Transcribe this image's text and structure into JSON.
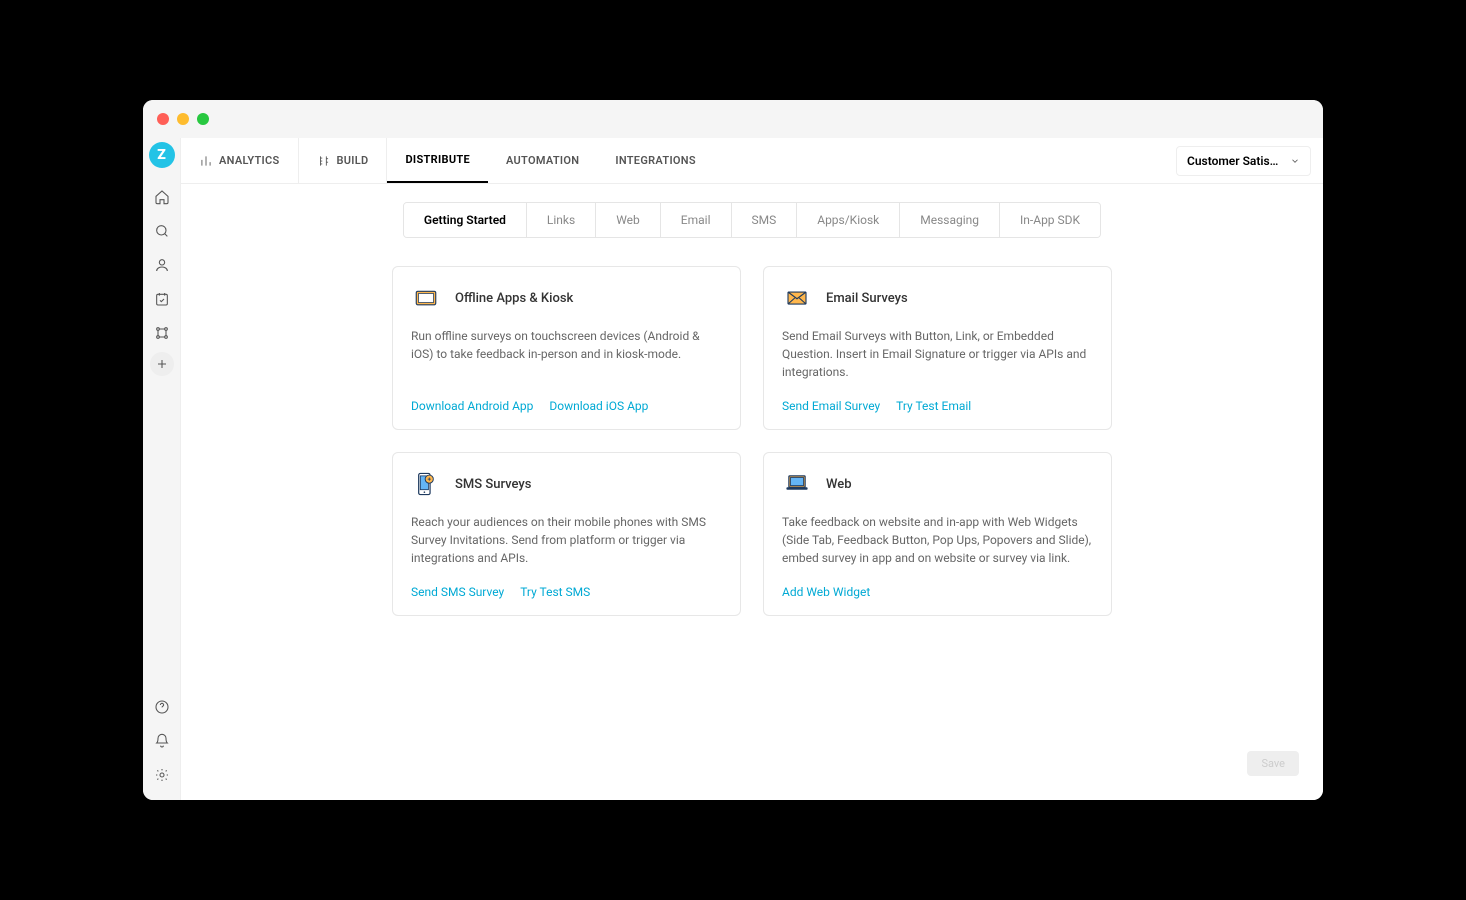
{
  "logo_letter": "Z",
  "topnav": {
    "items": [
      {
        "label": "ANALYTICS",
        "has_icon": true
      },
      {
        "label": "BUILD",
        "has_icon": true
      },
      {
        "label": "DISTRIBUTE",
        "active": true
      },
      {
        "label": "AUTOMATION"
      },
      {
        "label": "INTEGRATIONS"
      }
    ]
  },
  "project_selector": "Customer Satisfaction ...",
  "subnav": {
    "items": [
      {
        "label": "Getting Started",
        "active": true
      },
      {
        "label": "Links"
      },
      {
        "label": "Web"
      },
      {
        "label": "Email"
      },
      {
        "label": "SMS"
      },
      {
        "label": "Apps/Kiosk"
      },
      {
        "label": "Messaging"
      },
      {
        "label": "In-App SDK"
      }
    ]
  },
  "cards": [
    {
      "title": "Offline Apps & Kiosk",
      "desc": "Run offline surveys on touchscreen devices (Android & iOS) to take feedback in-person and in kiosk-mode.",
      "links": [
        "Download Android App",
        "Download iOS App"
      ]
    },
    {
      "title": "Email Surveys",
      "desc": "Send Email Surveys with Button, Link, or Embedded Question. Insert in Email Signature or trigger via APIs and integrations.",
      "links": [
        "Send Email Survey",
        "Try Test Email"
      ]
    },
    {
      "title": "SMS Surveys",
      "desc": "Reach your audiences on their mobile phones with SMS Survey Invitations. Send from platform or trigger via integrations and APIs.",
      "links": [
        "Send SMS Survey",
        "Try Test SMS"
      ]
    },
    {
      "title": "Web",
      "desc": "Take feedback on website and in-app with Web Widgets (Side Tab, Feedback Button, Pop Ups, Popovers and Slide), embed survey in app and on website or survey via link.",
      "links": [
        "Add Web Widget"
      ]
    }
  ],
  "save_button": "Save"
}
